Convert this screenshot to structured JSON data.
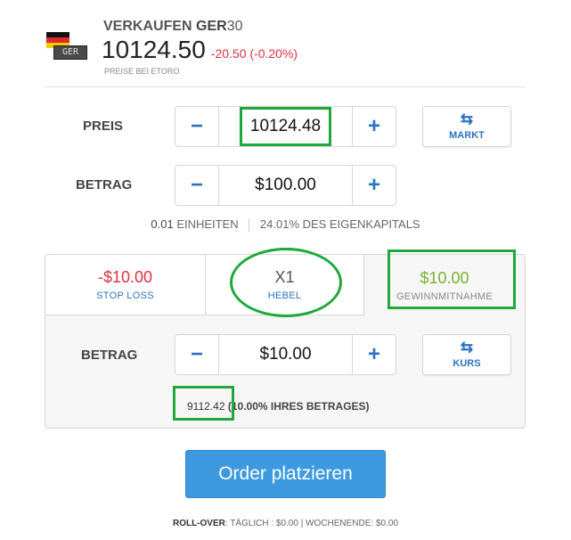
{
  "header": {
    "action": "VERKAUFEN",
    "symbol_letters": "GER",
    "symbol_number": "30",
    "badge_text": "GER",
    "price": "10124.50",
    "change": "-20.50 (-0.20%)",
    "source": "PREISE BEI ETORO"
  },
  "colors": {
    "accent_blue": "#2a74c2",
    "negative_red": "#e0303e",
    "positive_green": "#7ab12f",
    "order_button": "#3d9ae0",
    "highlight_green": "#1fa83b"
  },
  "preis": {
    "label": "PREIS",
    "minus": "−",
    "value": "10124.48",
    "plus": "+",
    "market_icon": "⇆",
    "market_label": "MARKT"
  },
  "betrag": {
    "label": "BETRAG",
    "minus": "−",
    "value": "$100.00",
    "plus": "+"
  },
  "units": {
    "count": "0.01",
    "units_label": "EINHEITEN",
    "equity": "24.01% DES EIGENKAPITALS"
  },
  "tabs": [
    {
      "value": "-$10.00",
      "label": "STOP LOSS"
    },
    {
      "value": "X1",
      "label": "HEBEL"
    },
    {
      "value": "$10.00",
      "label": "GEWINNMITNAHME"
    }
  ],
  "tp": {
    "label": "BETRAG",
    "minus": "−",
    "value": "$10.00",
    "plus": "+",
    "rate_icon": "⇆",
    "rate_label": "KURS",
    "rate_value": "9112.42",
    "pct_text": "(10.00% IHRES BETRAGES)"
  },
  "order_button": "Order platzieren",
  "footer": {
    "rollover_label": "ROLL-OVER",
    "rollover_text": ": TÄGLICH : $0.00 | WOCHENENDE: $0.00"
  }
}
